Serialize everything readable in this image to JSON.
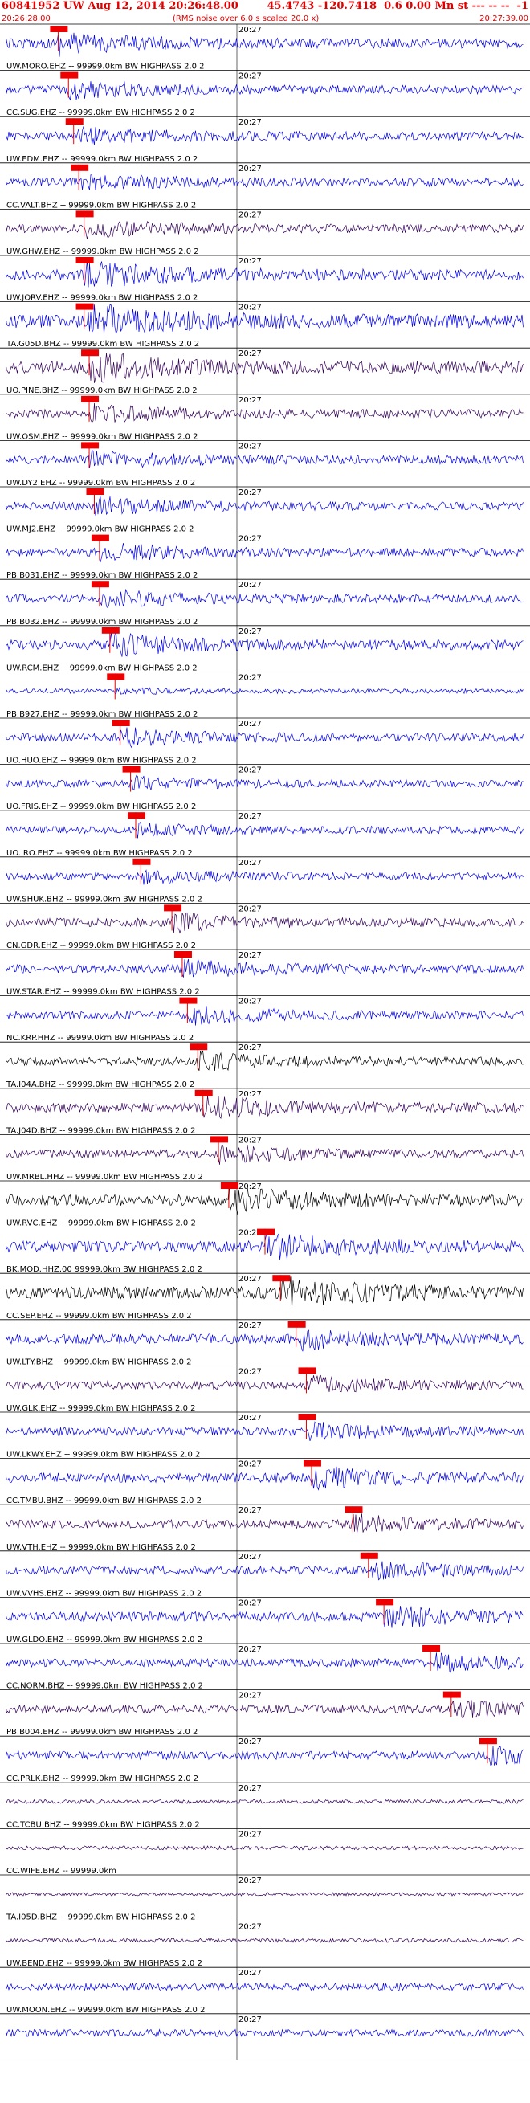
{
  "header": {
    "title": "60841952 UW Aug 12, 2014 20:26:48.00",
    "event": "45.4743 -120.7418  0.6 0.00 Mn st --- -- --  -1",
    "start_time": "20:26:28.00",
    "noise_note": "(RMS noise over 6.0 s scaled 20.0 x)",
    "end_time": "20:27:39.00"
  },
  "colors": {
    "blue": "#0000e6",
    "dark": "#33005a",
    "black": "#000000",
    "pick": "#ee0000",
    "label": "#000000"
  },
  "chart_data": {
    "type": "line",
    "title": "60841952 UW Aug 12, 2014 20:26:48.00",
    "x_range": [
      "20:26:28.00",
      "20:27:39.00"
    ],
    "minute_tick_label": "20:27",
    "grid": false,
    "traces": [
      {
        "label": "",
        "color": "blue",
        "amp": 0.5,
        "pick": 0.1
      },
      {
        "label": "UW.MORO.EHZ -- 99999.0km BW  HIGHPASS  2.0  2",
        "color": "blue",
        "amp": 0.4,
        "pick": 0.12
      },
      {
        "label": "CC.SUG.EHZ -- 99999.0km BW  HIGHPASS  2.0  2",
        "color": "blue",
        "amp": 0.4,
        "pick": 0.13
      },
      {
        "label": "UW.EDM.EHZ -- 99999.0km BW  HIGHPASS  2.0  2",
        "color": "blue",
        "amp": 0.4,
        "pick": 0.14
      },
      {
        "label": "CC.VALT.BHZ -- 99999.0km BW  HIGHPASS  2.0  2",
        "color": "dark",
        "amp": 0.4,
        "pick": 0.15
      },
      {
        "label": "UW.GHW.EHZ -- 99999.0km BW  HIGHPASS  2.0  2",
        "color": "blue",
        "amp": 0.6,
        "pick": 0.15
      },
      {
        "label": "UW.JORV.EHZ -- 99999.0km BW  HIGHPASS  2.0  2",
        "color": "blue",
        "amp": 0.8,
        "pick": 0.15
      },
      {
        "label": "TA.G05D.BHZ -- 99999.0km BW  HIGHPASS  2.0  2",
        "color": "dark",
        "amp": 0.7,
        "pick": 0.16
      },
      {
        "label": "UO.PINE.BHZ -- 99999.0km BW  HIGHPASS  2.0  2",
        "color": "dark",
        "amp": 0.4,
        "pick": 0.16
      },
      {
        "label": "UW.OSM.EHZ -- 99999.0km BW  HIGHPASS  2.0  2",
        "color": "blue",
        "amp": 0.4,
        "pick": 0.16
      },
      {
        "label": "UW.DY2.EHZ -- 99999.0km BW  HIGHPASS  2.0  2",
        "color": "blue",
        "amp": 0.4,
        "pick": 0.17
      },
      {
        "label": "UW.MJ2.EHZ -- 99999.0km BW  HIGHPASS  2.0  2",
        "color": "blue",
        "amp": 0.4,
        "pick": 0.18
      },
      {
        "label": "PB.B031.EHZ -- 99999.0km BW  HIGHPASS  2.0  2",
        "color": "blue",
        "amp": 0.4,
        "pick": 0.18
      },
      {
        "label": "PB.B032.EHZ -- 99999.0km BW  HIGHPASS  2.0  2",
        "color": "blue",
        "amp": 0.5,
        "pick": 0.2
      },
      {
        "label": "UW.RCM.EHZ -- 99999.0km BW  HIGHPASS  2.0  2",
        "color": "blue",
        "amp": 0.1,
        "pick": 0.21
      },
      {
        "label": "PB.B927.EHZ -- 99999.0km BW  HIGHPASS  2.0  2",
        "color": "blue",
        "amp": 0.4,
        "pick": 0.22
      },
      {
        "label": "UO.HUO.EHZ -- 99999.0km BW  HIGHPASS  2.0  2",
        "color": "blue",
        "amp": 0.3,
        "pick": 0.24
      },
      {
        "label": "UO.FRIS.EHZ -- 99999.0km BW  HIGHPASS  2.0  2",
        "color": "blue",
        "amp": 0.3,
        "pick": 0.25
      },
      {
        "label": "UO.IRO.EHZ -- 99999.0km BW  HIGHPASS  2.0  2",
        "color": "blue",
        "amp": 0.3,
        "pick": 0.26
      },
      {
        "label": "UW.SHUK.BHZ -- 99999.0km BW  HIGHPASS  2.0  2",
        "color": "dark",
        "amp": 0.4,
        "pick": 0.32
      },
      {
        "label": "CN.GDR.EHZ -- 99999.0km BW  HIGHPASS  2.0  2",
        "color": "blue",
        "amp": 0.4,
        "pick": 0.34
      },
      {
        "label": "UW.STAR.EHZ -- 99999.0km BW  HIGHPASS  2.0  2",
        "color": "blue",
        "amp": 0.4,
        "pick": 0.35
      },
      {
        "label": "NC.KRP.HHZ -- 99999.0km BW  HIGHPASS  2.0  2",
        "color": "black",
        "amp": 0.4,
        "pick": 0.37
      },
      {
        "label": "TA.I04A.BHZ -- 99999.0km BW  HIGHPASS  2.0  2",
        "color": "dark",
        "amp": 0.5,
        "pick": 0.38
      },
      {
        "label": "TA.J04D.BHZ -- 99999.0km BW  HIGHPASS  2.0  2",
        "color": "dark",
        "amp": 0.4,
        "pick": 0.41
      },
      {
        "label": "UW.MRBL.HHZ -- 99999.0km BW  HIGHPASS  2.0  2",
        "color": "black",
        "amp": 0.6,
        "pick": 0.43
      },
      {
        "label": "UW.RVC.EHZ -- 99999.0km BW  HIGHPASS  2.0  2",
        "color": "blue",
        "amp": 0.6,
        "pick": 0.5
      },
      {
        "label": "BK.MOD.HHZ.00 99999.0km BW  HIGHPASS  2.0  2",
        "color": "black",
        "amp": 0.7,
        "pick": 0.53
      },
      {
        "label": "CC.SEP.EHZ -- 99999.0km BW  HIGHPASS  2.0  2",
        "color": "blue",
        "amp": 0.5,
        "pick": 0.56
      },
      {
        "label": "UW.LTY.BHZ -- 99999.0km BW  HIGHPASS  2.0  2",
        "color": "dark",
        "amp": 0.4,
        "pick": 0.58
      },
      {
        "label": "UW.GLK.EHZ -- 99999.0km BW  HIGHPASS  2.0  2",
        "color": "blue",
        "amp": 0.4,
        "pick": 0.58
      },
      {
        "label": "UW.LKWY.EHZ -- 99999.0km BW  HIGHPASS  2.0  2",
        "color": "blue",
        "amp": 0.5,
        "pick": 0.59
      },
      {
        "label": "CC.TMBU.BHZ -- 99999.0km BW  HIGHPASS  2.0  2",
        "color": "dark",
        "amp": 0.4,
        "pick": 0.67
      },
      {
        "label": "UW.VTH.EHZ -- 99999.0km BW  HIGHPASS  2.0  2",
        "color": "blue",
        "amp": 0.4,
        "pick": 0.7
      },
      {
        "label": "UW.VVHS.EHZ -- 99999.0km BW  HIGHPASS  2.0  2",
        "color": "blue",
        "amp": 0.5,
        "pick": 0.73
      },
      {
        "label": "UW.GLDO.EHZ -- 99999.0km BW  HIGHPASS  2.0  2",
        "color": "blue",
        "amp": 0.4,
        "pick": 0.82
      },
      {
        "label": "CC.NORM.BHZ -- 99999.0km BW  HIGHPASS  2.0  2",
        "color": "dark",
        "amp": 0.4,
        "pick": 0.86
      },
      {
        "label": "PB.B004.EHZ -- 99999.0km BW  HIGHPASS  2.0  2",
        "color": "blue",
        "amp": 0.4,
        "pick": 0.93
      },
      {
        "label": "CC.PRLK.BHZ -- 99999.0km BW  HIGHPASS  2.0  2",
        "color": "dark",
        "amp": 0.05,
        "pick": null
      },
      {
        "label": "CC.TCBU.BHZ -- 99999.0km BW  HIGHPASS  2.0  2",
        "color": "dark",
        "amp": 0.05,
        "pick": null
      },
      {
        "label": "CC.WIFE.BHZ -- 99999.0km",
        "color": "dark",
        "amp": 0.0,
        "pick": null
      },
      {
        "label": "TA.I05D.BHZ -- 99999.0km BW  HIGHPASS  2.0  2",
        "color": "dark",
        "amp": 0.05,
        "pick": null
      },
      {
        "label": "UW.BEND.EHZ -- 99999.0km BW  HIGHPASS  2.0  2",
        "color": "blue",
        "amp": 0.3,
        "pick": null
      },
      {
        "label": "UW.MOON.EHZ -- 99999.0km BW  HIGHPASS  2.0  2",
        "color": "blue",
        "amp": 0.3,
        "pick": null
      }
    ]
  }
}
